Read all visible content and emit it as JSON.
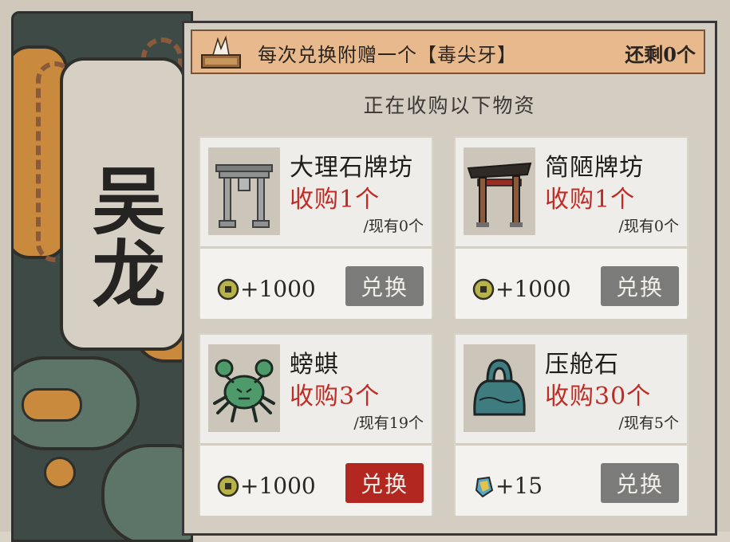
{
  "merchant": {
    "name": "吴龙"
  },
  "banner": {
    "bonus_text": "每次兑换附赠一个【毒尖牙】",
    "remaining_text": "还剩0个"
  },
  "subtitle": "正在收购以下物资",
  "items": [
    {
      "name": "大理石牌坊",
      "need": "收购1个",
      "have": "/现有0个",
      "price_icon": "copper-coin-icon",
      "price": "+1000",
      "button": "兑换",
      "button_state": "disabled",
      "thumb_icon": "marble-archway-icon"
    },
    {
      "name": "简陋牌坊",
      "need": "收购1个",
      "have": "/现有0个",
      "price_icon": "copper-coin-icon",
      "price": "+1000",
      "button": "兑换",
      "button_state": "disabled",
      "thumb_icon": "simple-archway-icon"
    },
    {
      "name": "螃蜞",
      "need": "收购3个",
      "have": "/现有19个",
      "price_icon": "copper-coin-icon",
      "price": "+1000",
      "button": "兑换",
      "button_state": "active",
      "thumb_icon": "crab-icon"
    },
    {
      "name": "压舱石",
      "need": "收购30个",
      "have": "/现有5个",
      "price_icon": "gem-icon",
      "price": "+15",
      "button": "兑换",
      "button_state": "disabled",
      "thumb_icon": "ballast-stone-icon"
    }
  ],
  "colors": {
    "need_red": "#c22b25",
    "button_active": "#b2271f",
    "button_disabled": "#7b7b79",
    "banner_bg": "#e8b98c"
  }
}
